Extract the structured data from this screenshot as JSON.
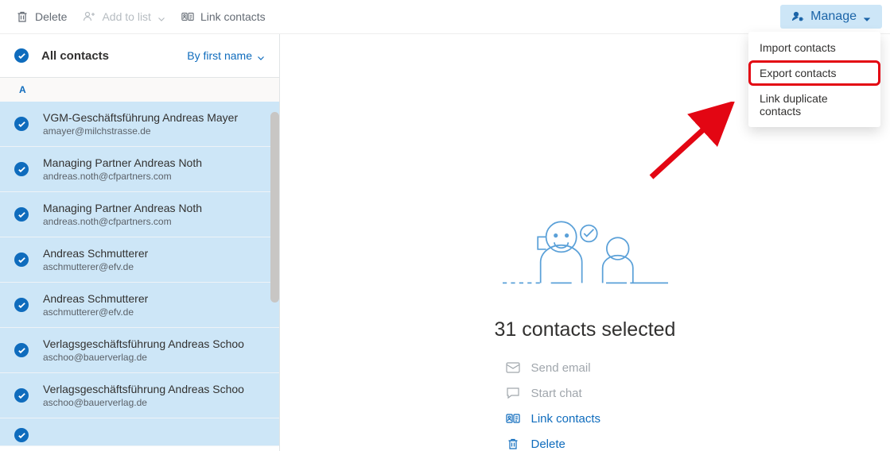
{
  "toolbar": {
    "delete_label": "Delete",
    "add_to_list_label": "Add to list",
    "link_contacts_label": "Link contacts",
    "manage_label": "Manage"
  },
  "manage_menu": {
    "items": [
      {
        "label": "Import contacts"
      },
      {
        "label": "Export contacts"
      },
      {
        "label": "Link duplicate contacts"
      }
    ]
  },
  "sidebar": {
    "title": "All contacts",
    "sort_label": "By first name",
    "section_letter": "A",
    "contacts": [
      {
        "name": "VGM-Geschäftsführung Andreas Mayer",
        "email": "amayer@milchstrasse.de"
      },
      {
        "name": "Managing Partner Andreas Noth",
        "email": "andreas.noth@cfpartners.com"
      },
      {
        "name": "Managing Partner Andreas Noth",
        "email": "andreas.noth@cfpartners.com"
      },
      {
        "name": "Andreas Schmutterer",
        "email": "aschmutterer@efv.de"
      },
      {
        "name": "Andreas Schmutterer",
        "email": "aschmutterer@efv.de"
      },
      {
        "name": "Verlagsgeschäftsführung Andreas Schoo",
        "email": "aschoo@bauerverlag.de"
      },
      {
        "name": "Verlagsgeschäftsführung Andreas Schoo",
        "email": "aschoo@bauerverlag.de"
      }
    ],
    "next_contact_name": ""
  },
  "main": {
    "selected_title": "31 contacts selected",
    "actions": {
      "send_email": "Send email",
      "start_chat": "Start chat",
      "link_contacts": "Link contacts",
      "delete": "Delete"
    }
  },
  "colors": {
    "accent": "#0f6cbd",
    "selection": "#cde6f7",
    "annotation": "#e30613"
  }
}
